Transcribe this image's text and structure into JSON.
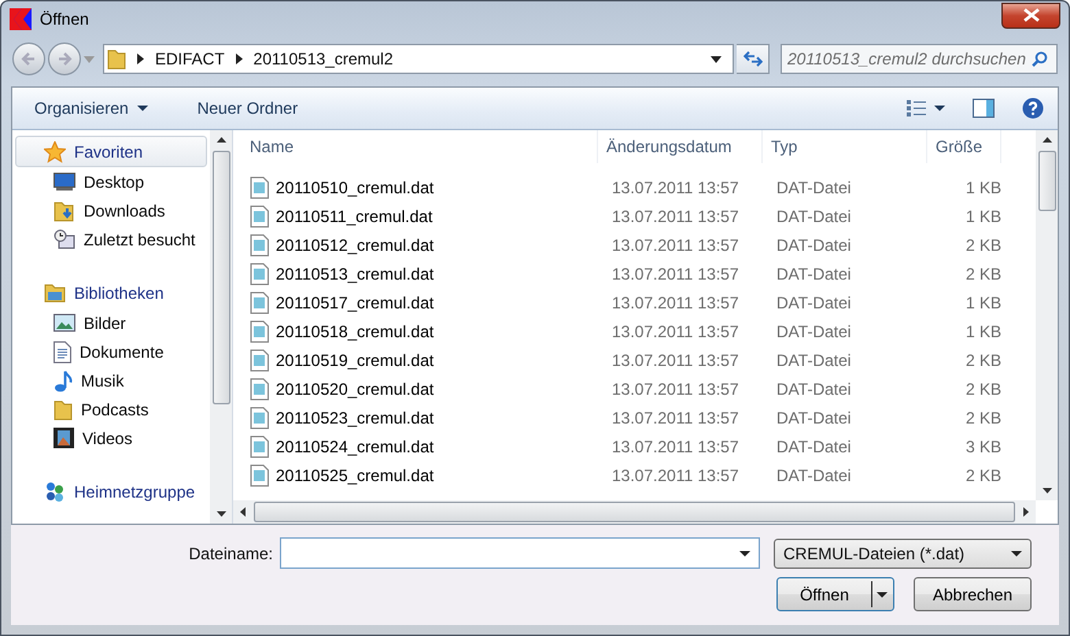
{
  "window": {
    "title": "Öffnen"
  },
  "address": {
    "crumbs": [
      "EDIFACT",
      "20110513_cremul2"
    ]
  },
  "search": {
    "placeholder": "20110513_cremul2 durchsuchen"
  },
  "toolbar": {
    "organize": "Organisieren",
    "new_folder": "Neuer Ordner"
  },
  "sidebar": {
    "groups": [
      {
        "label": "Favoriten",
        "kind": "star",
        "selected": true,
        "children": [
          {
            "label": "Desktop",
            "kind": "desktop"
          },
          {
            "label": "Downloads",
            "kind": "download"
          },
          {
            "label": "Zuletzt besucht",
            "kind": "recent"
          }
        ]
      },
      {
        "label": "Bibliotheken",
        "kind": "library",
        "selected": false,
        "children": [
          {
            "label": "Bilder",
            "kind": "image"
          },
          {
            "label": "Dokumente",
            "kind": "document"
          },
          {
            "label": "Musik",
            "kind": "music"
          },
          {
            "label": "Podcasts",
            "kind": "folder"
          },
          {
            "label": "Videos",
            "kind": "video"
          }
        ]
      },
      {
        "label": "Heimnetzgruppe",
        "kind": "network",
        "selected": false
      }
    ]
  },
  "table": {
    "columns": [
      "Name",
      "Änderungsdatum",
      "Typ",
      "Größe"
    ],
    "rows": [
      {
        "name": "20110510_cremul.dat",
        "date": "13.07.2011 13:57",
        "type": "DAT-Datei",
        "size": "1 KB"
      },
      {
        "name": "20110511_cremul.dat",
        "date": "13.07.2011 13:57",
        "type": "DAT-Datei",
        "size": "1 KB"
      },
      {
        "name": "20110512_cremul.dat",
        "date": "13.07.2011 13:57",
        "type": "DAT-Datei",
        "size": "2 KB"
      },
      {
        "name": "20110513_cremul.dat",
        "date": "13.07.2011 13:57",
        "type": "DAT-Datei",
        "size": "2 KB"
      },
      {
        "name": "20110517_cremul.dat",
        "date": "13.07.2011 13:57",
        "type": "DAT-Datei",
        "size": "1 KB"
      },
      {
        "name": "20110518_cremul.dat",
        "date": "13.07.2011 13:57",
        "type": "DAT-Datei",
        "size": "1 KB"
      },
      {
        "name": "20110519_cremul.dat",
        "date": "13.07.2011 13:57",
        "type": "DAT-Datei",
        "size": "2 KB"
      },
      {
        "name": "20110520_cremul.dat",
        "date": "13.07.2011 13:57",
        "type": "DAT-Datei",
        "size": "2 KB"
      },
      {
        "name": "20110523_cremul.dat",
        "date": "13.07.2011 13:57",
        "type": "DAT-Datei",
        "size": "2 KB"
      },
      {
        "name": "20110524_cremul.dat",
        "date": "13.07.2011 13:57",
        "type": "DAT-Datei",
        "size": "3 KB"
      },
      {
        "name": "20110525_cremul.dat",
        "date": "13.07.2011 13:57",
        "type": "DAT-Datei",
        "size": "2 KB"
      }
    ]
  },
  "filename": {
    "label": "Dateiname:"
  },
  "filetype": {
    "value": "CREMUL-Dateien (*.dat)"
  },
  "buttons": [
    {
      "label": "Öffnen",
      "kind": "split"
    },
    {
      "label": "Abbrechen",
      "kind": "plain"
    }
  ]
}
